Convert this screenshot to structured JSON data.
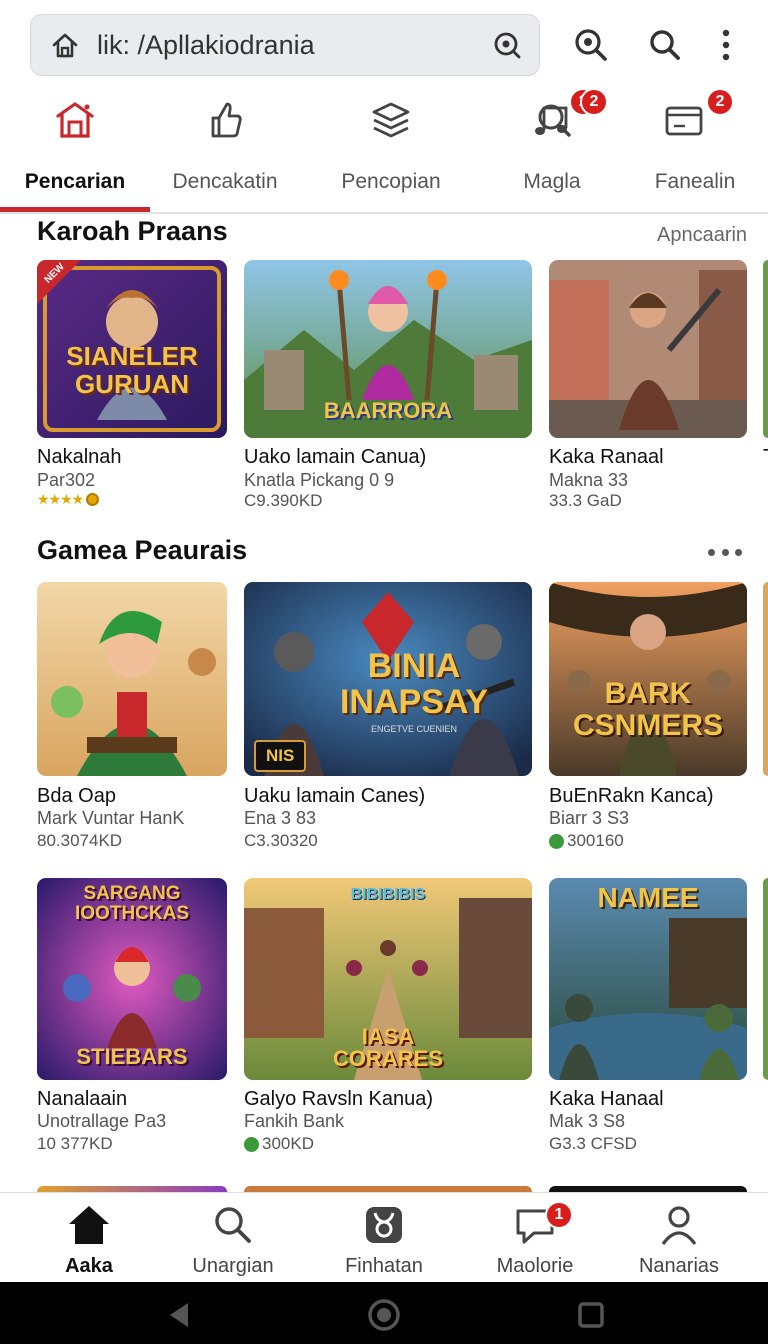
{
  "browser": {
    "url": "lik: /Apllakiodrania",
    "home_icon": "home-icon",
    "lens_icon": "lens-icon"
  },
  "toolbar": {
    "icons": [
      "zoom-search-icon",
      "search-icon",
      "more-vertical-icon"
    ]
  },
  "tabs": [
    {
      "label": "Pencarian",
      "icon": "store-icon",
      "badge": ""
    },
    {
      "label": "Dencakatin",
      "icon": "thumbs-up-icon",
      "badge": ""
    },
    {
      "label": "Pencopian",
      "icon": "layers-icon",
      "badge": ""
    },
    {
      "label": "Magla",
      "icon": "music-icon",
      "badge": "1"
    },
    {
      "label": "Fanealin",
      "icon": "search-icon",
      "badge": "2"
    },
    {
      "label": "",
      "icon": "card-icon",
      "badge": "2"
    }
  ],
  "section1": {
    "title": "Karoah Praans",
    "link": "Apncaarin",
    "cards": [
      {
        "thumb_text": "SIANELER GURUAN",
        "corner_tag": "NEW",
        "title": "Nakalnah",
        "sub": "Par302",
        "meta": "",
        "stars": "★★★★",
        "rating_icon": "coin-icon"
      },
      {
        "thumb_text": "BAARRORA",
        "title": "Uako lamain Canua)",
        "sub": "Knatla Pickang 0 9",
        "meta": "C9.390KD"
      },
      {
        "thumb_text": "",
        "title": "Kaka Ranaal",
        "sub": "Makna 33",
        "meta": "33.3 GaD"
      },
      {
        "thumb_text": "",
        "title": "T",
        "sub": "",
        "meta": ""
      }
    ]
  },
  "section2": {
    "title": "Gamea Peaurais",
    "more_icon": "more-horizontal-icon",
    "cards": [
      {
        "thumb_text": "",
        "title": "Bda Oap",
        "sub": "Mark Vuntar HanK",
        "meta": "80.3074KD"
      },
      {
        "thumb_text": "BINIA INAPSAY",
        "small_text": "NIS",
        "tagline": "ENGETVE CUENIEN",
        "title": "Uaku lamain Canes)",
        "sub": "Ena 3 83",
        "meta": "C3.30320"
      },
      {
        "thumb_text": "BARK CSNMERS",
        "title": "BuEnRakn Kanca)",
        "sub": "Biarr 3 S3",
        "meta": "300160",
        "meta_icon": "green-dot-icon"
      }
    ]
  },
  "section3": {
    "cards": [
      {
        "thumb_text": "SARGANG IOOTHCKAS",
        "thumb_text2": "STIEBARS",
        "title": "Nanalaain",
        "sub": "Unotrallage Pa3",
        "meta": "10 377KD"
      },
      {
        "thumb_text": "IASA CORARES",
        "thumb_text_top": "BIBIBIBIS",
        "title": "Galyo Ravsln Kanua)",
        "sub": "Fankih Bank",
        "meta": "300KD",
        "meta_icon": "green-dot-icon"
      },
      {
        "thumb_text": "NAMEE",
        "title": "Kaka Hanaal",
        "sub": "Mak 3 S8",
        "meta": "G3.3 CFSD"
      }
    ]
  },
  "bottom_nav": [
    {
      "label": "Aaka",
      "icon": "home-icon",
      "badge": ""
    },
    {
      "label": "Unargian",
      "icon": "search-icon",
      "badge": ""
    },
    {
      "label": "Finhatan",
      "icon": "taurus-icon",
      "badge": ""
    },
    {
      "label": "Maolorie",
      "icon": "chat-icon",
      "badge": "1"
    },
    {
      "label": "Nanarias",
      "icon": "person-icon",
      "badge": ""
    }
  ],
  "colors": {
    "accent": "#c8282b",
    "badge": "#d81d1d",
    "urlbar_bg": "#e9ebee"
  }
}
